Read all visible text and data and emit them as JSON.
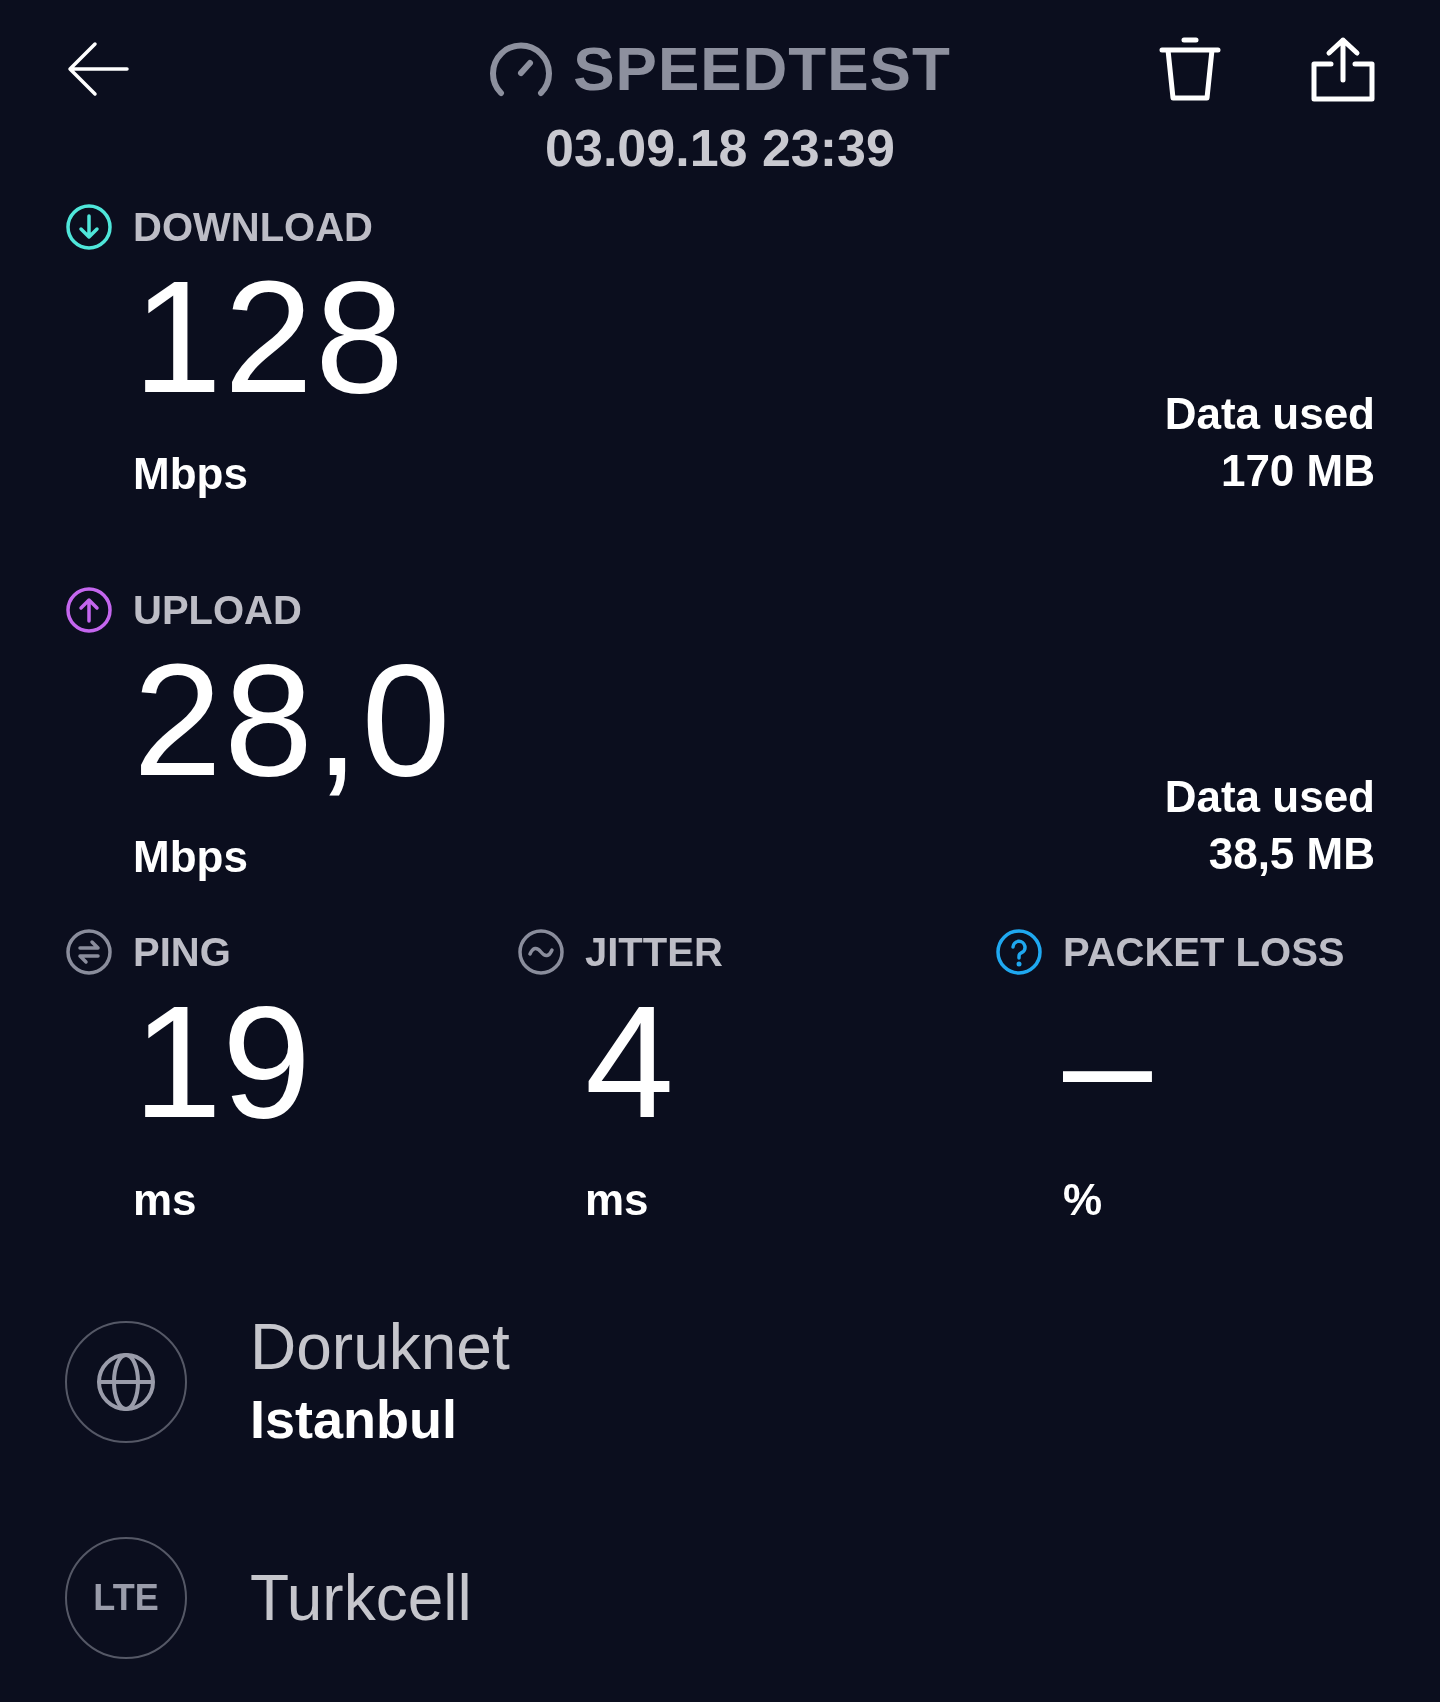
{
  "header": {
    "title": "SPEEDTEST",
    "date": "03.09.18 23:39"
  },
  "results": [
    {
      "kind": "download",
      "label": "DOWNLOAD",
      "value": "128",
      "unit": "Mbps",
      "data_label": "Data used",
      "data_value": "170 MB"
    },
    {
      "kind": "upload",
      "label": "UPLOAD",
      "value": "28,0",
      "unit": "Mbps",
      "data_label": "Data used",
      "data_value": "38,5 MB"
    }
  ],
  "metrics": [
    {
      "kind": "ping",
      "label": "PING",
      "value": "19",
      "unit": "ms"
    },
    {
      "kind": "jitter",
      "label": "JITTER",
      "value": "4",
      "unit": "ms"
    },
    {
      "kind": "packet_loss",
      "label": "PACKET LOSS",
      "value": "–",
      "unit": "%"
    }
  ],
  "server": {
    "provider": "Doruknet",
    "location": "Istanbul"
  },
  "carrier": {
    "badge": "LTE",
    "name": "Turkcell"
  }
}
